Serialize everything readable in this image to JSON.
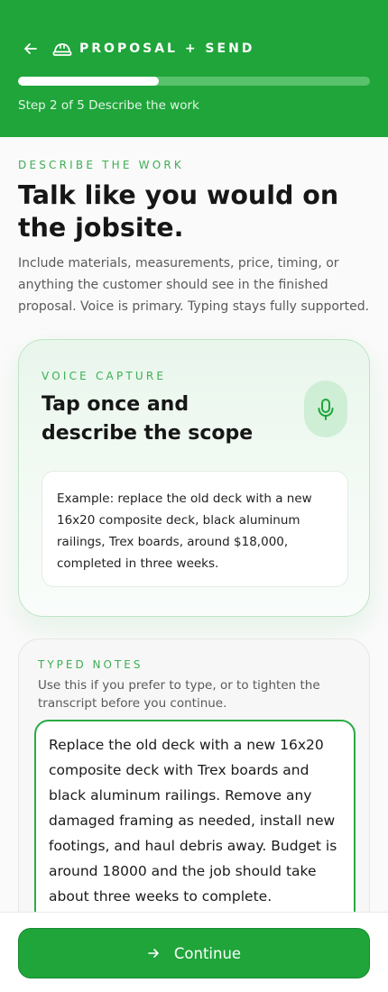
{
  "header": {
    "title": "PROPOSAL + SEND",
    "progress": 0.4,
    "step_text": "Step 2 of 5 Describe the work"
  },
  "main": {
    "kicker": "DESCRIBE THE WORK",
    "title": "Talk like you would on the jobsite.",
    "intro": "Include materials, measurements, price, timing, or anything the customer should see in the finished proposal. Voice is primary. Typing stays fully supported."
  },
  "voice": {
    "kicker": "VOICE CAPTURE",
    "title": "Tap once and describe the scope",
    "example": "Example: replace the old deck with a new 16x20 composite deck, black aluminum railings, Trex boards, around $18,000, completed in three weeks."
  },
  "typed": {
    "kicker": "TYPED NOTES",
    "help": "Use this if you prefer to type, or to tighten the transcript before you continue.",
    "value": "Replace the old deck with a new 16x20 composite deck with Trex boards and black aluminum railings. Remove any damaged framing as needed, install new footings, and haul debris away. Budget is around 18000 and the job should take about three weeks to complete."
  },
  "footer": {
    "continue_label": "Continue"
  },
  "colors": {
    "brand_green": "#1fa53a",
    "accent_green": "#3fae55"
  },
  "icons": [
    "back-arrow-icon",
    "hard-hat-icon",
    "microphone-icon",
    "arrow-right-icon"
  ]
}
